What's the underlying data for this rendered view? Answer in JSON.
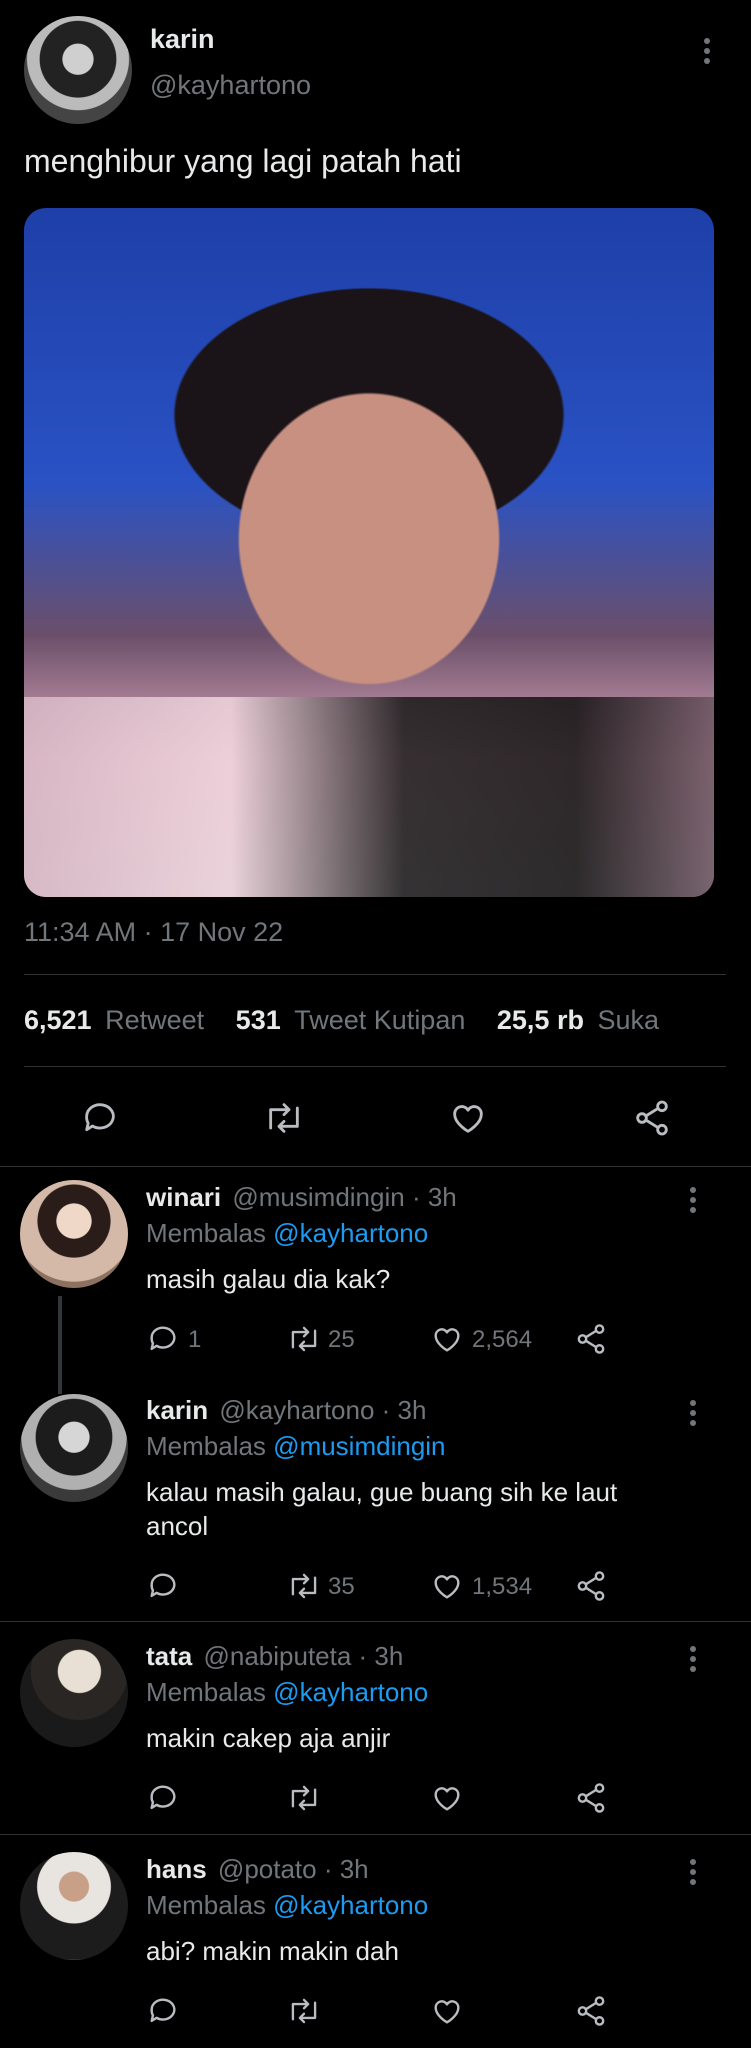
{
  "tweet": {
    "author_name": "karin",
    "author_handle": "@kayhartono",
    "text": "menghibur yang lagi patah hati",
    "timestamp": "11:34 AM · 17 Nov 22",
    "stats": {
      "retweets": "6,521",
      "retweets_label": "Retweet",
      "quotes": "531",
      "quotes_label": "Tweet Kutipan",
      "likes": "25,5 rb",
      "likes_label": "Suka"
    }
  },
  "replies": [
    {
      "name": "winari",
      "handle_time": "@musimdingin · 3h",
      "replying_prefix": "Membalas",
      "replying_to": "@kayhartono",
      "text": "masih galau dia kak?",
      "reply_count": "1",
      "retweet_count": "25",
      "like_count": "2,564"
    },
    {
      "name": "karin",
      "handle_time": "@kayhartono · 3h",
      "replying_prefix": "Membalas",
      "replying_to": "@musimdingin",
      "text_line1": "kalau masih galau, gue buang sih ke laut",
      "text_line2": "ancol",
      "reply_count": "",
      "retweet_count": "35",
      "like_count": "1,534"
    },
    {
      "name": "tata",
      "handle_time": "@nabiputeta · 3h",
      "replying_prefix": "Membalas",
      "replying_to": "@kayhartono",
      "text": "makin cakep aja anjir",
      "reply_count": "",
      "retweet_count": "",
      "like_count": ""
    },
    {
      "name": "hans",
      "handle_time": "@potato · 3h",
      "replying_prefix": "Membalas",
      "replying_to": "@kayhartono",
      "text": "abi? makin makin dah",
      "reply_count": "",
      "retweet_count": "",
      "like_count": ""
    }
  ],
  "colors": {
    "background": "#000000",
    "text": "#e7e9ea",
    "muted": "#71767b",
    "link": "#1d9bf0",
    "divider": "#2f3336"
  },
  "icons": [
    "more-icon",
    "reply-icon",
    "retweet-icon",
    "like-icon",
    "share-icon"
  ]
}
